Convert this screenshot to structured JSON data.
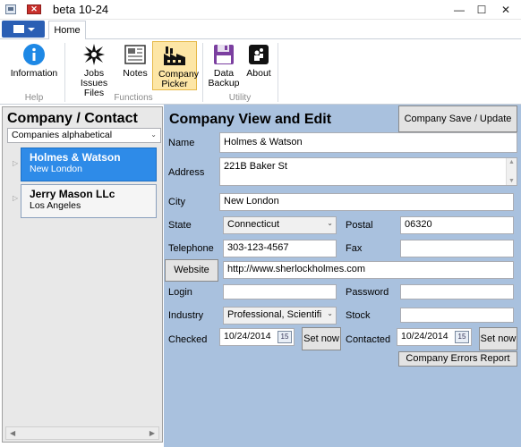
{
  "window": {
    "title": "beta 10-24",
    "controls": {
      "minimize": "—",
      "maximize": "☐",
      "close": "✕"
    }
  },
  "ribbon": {
    "tabs": [
      {
        "label": "Home"
      }
    ],
    "buttons": {
      "information": "Information",
      "jobs": "Jobs Issues Files",
      "notes": "Notes",
      "company_picker": "Company Picker",
      "data_backup": "Data Backup",
      "about": "About"
    },
    "groups": {
      "help": "Help",
      "functions": "Functions",
      "utility": "Utility"
    }
  },
  "left": {
    "title": "Company / Contact",
    "sort": "Companies alphabetical",
    "companies": [
      {
        "name": "Holmes & Watson",
        "city": "New London",
        "selected": true
      },
      {
        "name": "Jerry Mason LLc",
        "city": "Los Angeles",
        "selected": false
      }
    ]
  },
  "main": {
    "title": "Company View and Edit",
    "save_button": "Company Save / Update",
    "labels": {
      "name": "Name",
      "address": "Address",
      "city": "City",
      "state": "State",
      "postal": "Postal",
      "telephone": "Telephone",
      "fax": "Fax",
      "login": "Login",
      "password": "Password",
      "industry": "Industry",
      "stock": "Stock",
      "checked": "Checked",
      "contacted": "Contacted"
    },
    "website_button": "Website",
    "values": {
      "name": "Holmes & Watson",
      "address": "221B Baker St",
      "city": "New London",
      "state": "Connecticut",
      "postal": "06320",
      "telephone": "303-123-4567",
      "fax": "",
      "website": "http://www.sherlockholmes.com",
      "login": "",
      "password": "",
      "industry": "Professional, Scientifi",
      "stock": "",
      "checked": "10/24/2014",
      "contacted": "10/24/2014",
      "calendar_day": "15"
    },
    "set_now": "Set now",
    "errors_report": "Company Errors Report"
  },
  "colors": {
    "accent": "#2e8be8",
    "panel": "#a9c1de",
    "active_ribbon": "#fde6a6"
  }
}
